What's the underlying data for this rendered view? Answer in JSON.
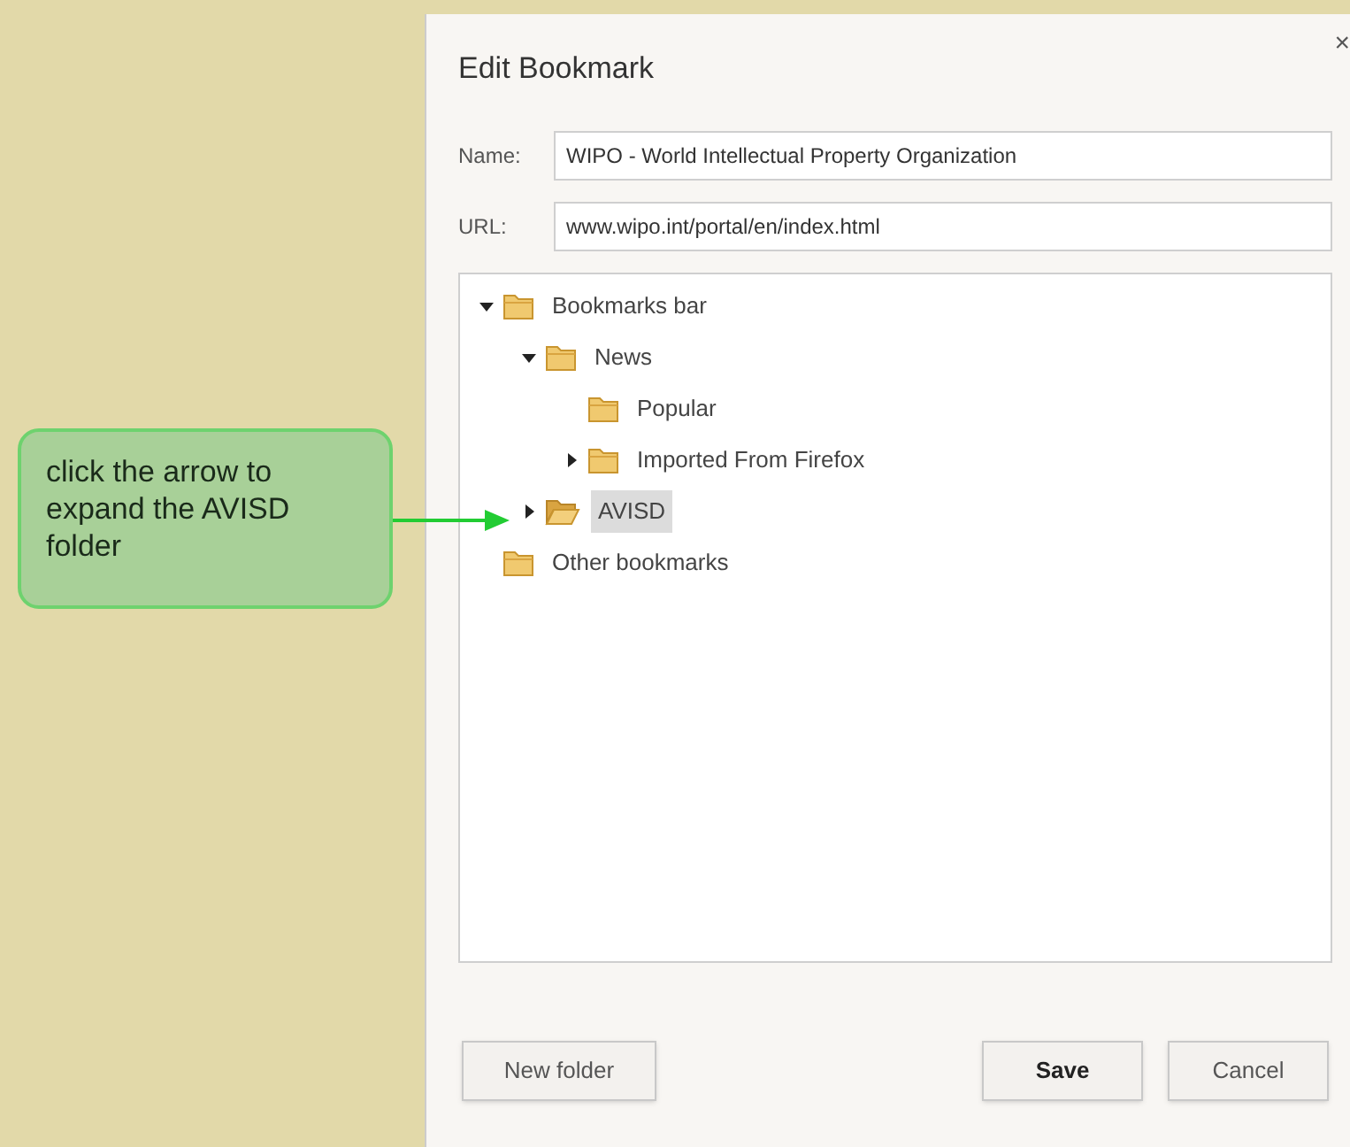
{
  "callout": {
    "text": "click the arrow to expand the AVISD folder"
  },
  "dialog": {
    "title": "Edit Bookmark",
    "close": "×",
    "fields": [
      {
        "label": "Name:",
        "value": "WIPO - World Intellectual Property Organization"
      },
      {
        "label": "URL:",
        "value": "www.wipo.int/portal/en/index.html"
      }
    ],
    "tree": [
      {
        "label": "Bookmarks bar",
        "expanded": true,
        "selected": false,
        "children": [
          {
            "label": "News",
            "expanded": true,
            "selected": false,
            "children": [
              {
                "label": "Popular",
                "selected": false
              },
              {
                "label": "Imported From Firefox",
                "expanded": false,
                "selected": false
              }
            ]
          },
          {
            "label": "AVISD",
            "expanded": false,
            "selected": true
          }
        ]
      },
      {
        "label": "Other bookmarks",
        "selected": false
      }
    ],
    "buttons": [
      {
        "label": "New folder",
        "kind": "secondary"
      },
      {
        "label": "Save",
        "kind": "primary"
      },
      {
        "label": "Cancel",
        "kind": "secondary"
      }
    ]
  }
}
